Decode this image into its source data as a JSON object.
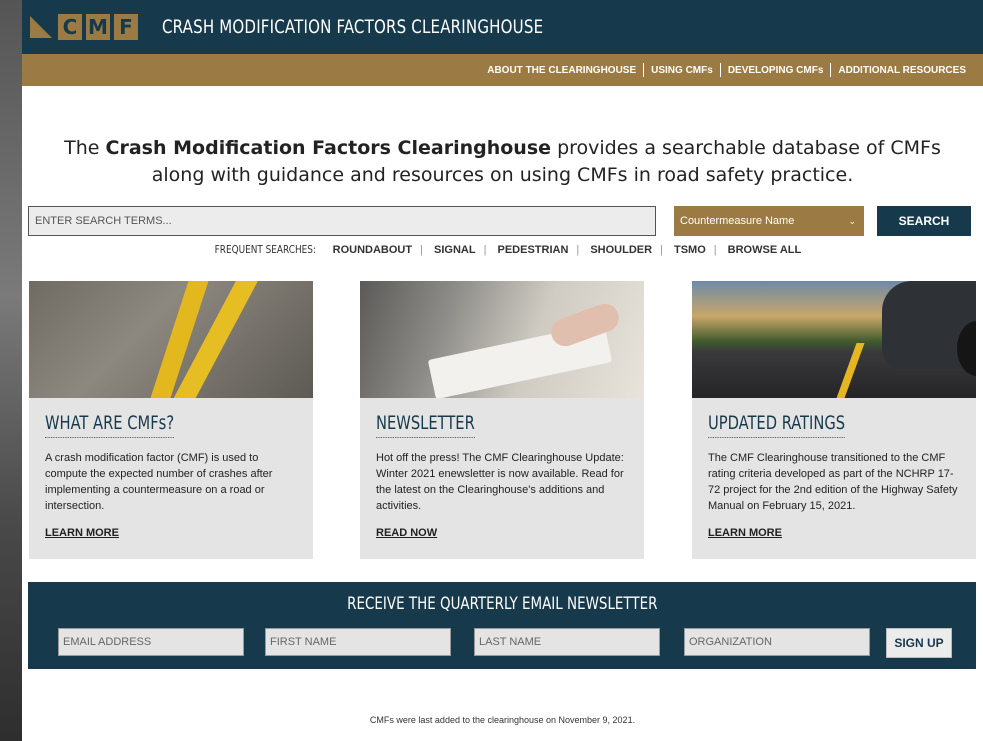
{
  "header": {
    "logo_letters": [
      "C",
      "M",
      "F"
    ],
    "site_title": "CRASH MODIFICATION FACTORS CLEARINGHOUSE",
    "nav": [
      "ABOUT THE CLEARINGHOUSE",
      "USING CMFs",
      "DEVELOPING CMFs",
      "ADDITIONAL RESOURCES"
    ]
  },
  "hero": {
    "prefix": "The ",
    "bold": "Crash Modification Factors Clearinghouse",
    "suffix": " provides a searchable database of CMFs along with guidance and resources on using CMFs in road safety practice."
  },
  "search": {
    "placeholder": "ENTER SEARCH TERMS...",
    "select_value": "Countermeasure Name",
    "button": "SEARCH",
    "frequent_label": "FREQUENT SEARCHES:",
    "frequent": [
      "ROUNDABOUT",
      "SIGNAL",
      "PEDESTRIAN",
      "SHOULDER",
      "TSMO",
      "BROWSE ALL"
    ]
  },
  "cards": [
    {
      "title": "WHAT ARE CMFs?",
      "body": "A crash modification factor (CMF) is used to compute the expected number of crashes after implementing a countermeasure on a road or intersection.",
      "link": "LEARN MORE"
    },
    {
      "title": "NEWSLETTER",
      "body": "Hot off the press! The CMF Clearinghouse Update: Winter 2021 enewsletter is now available. Read for the latest on the Clearinghouse's additions and activities.",
      "link": "READ NOW"
    },
    {
      "title": "UPDATED RATINGS",
      "body": "The CMF Clearinghouse transitioned to the CMF rating criteria developed as part of the NCHRP 17-72 project for the 2nd edition of the Highway Safety Manual on February 15, 2021.",
      "link": "LEARN MORE"
    }
  ],
  "newsletter": {
    "title": "RECEIVE THE QUARTERLY EMAIL NEWSLETTER",
    "email_placeholder": "EMAIL ADDRESS",
    "first_placeholder": "FIRST NAME",
    "last_placeholder": "LAST NAME",
    "org_placeholder": "ORGANIZATION",
    "button": "SIGN UP"
  },
  "footer": {
    "text": "CMFs were last added to the clearinghouse on November 9, 2021."
  },
  "colors": {
    "navy": "#17394c",
    "gold": "#9b7b43",
    "card_bg": "#e4e4e4"
  }
}
